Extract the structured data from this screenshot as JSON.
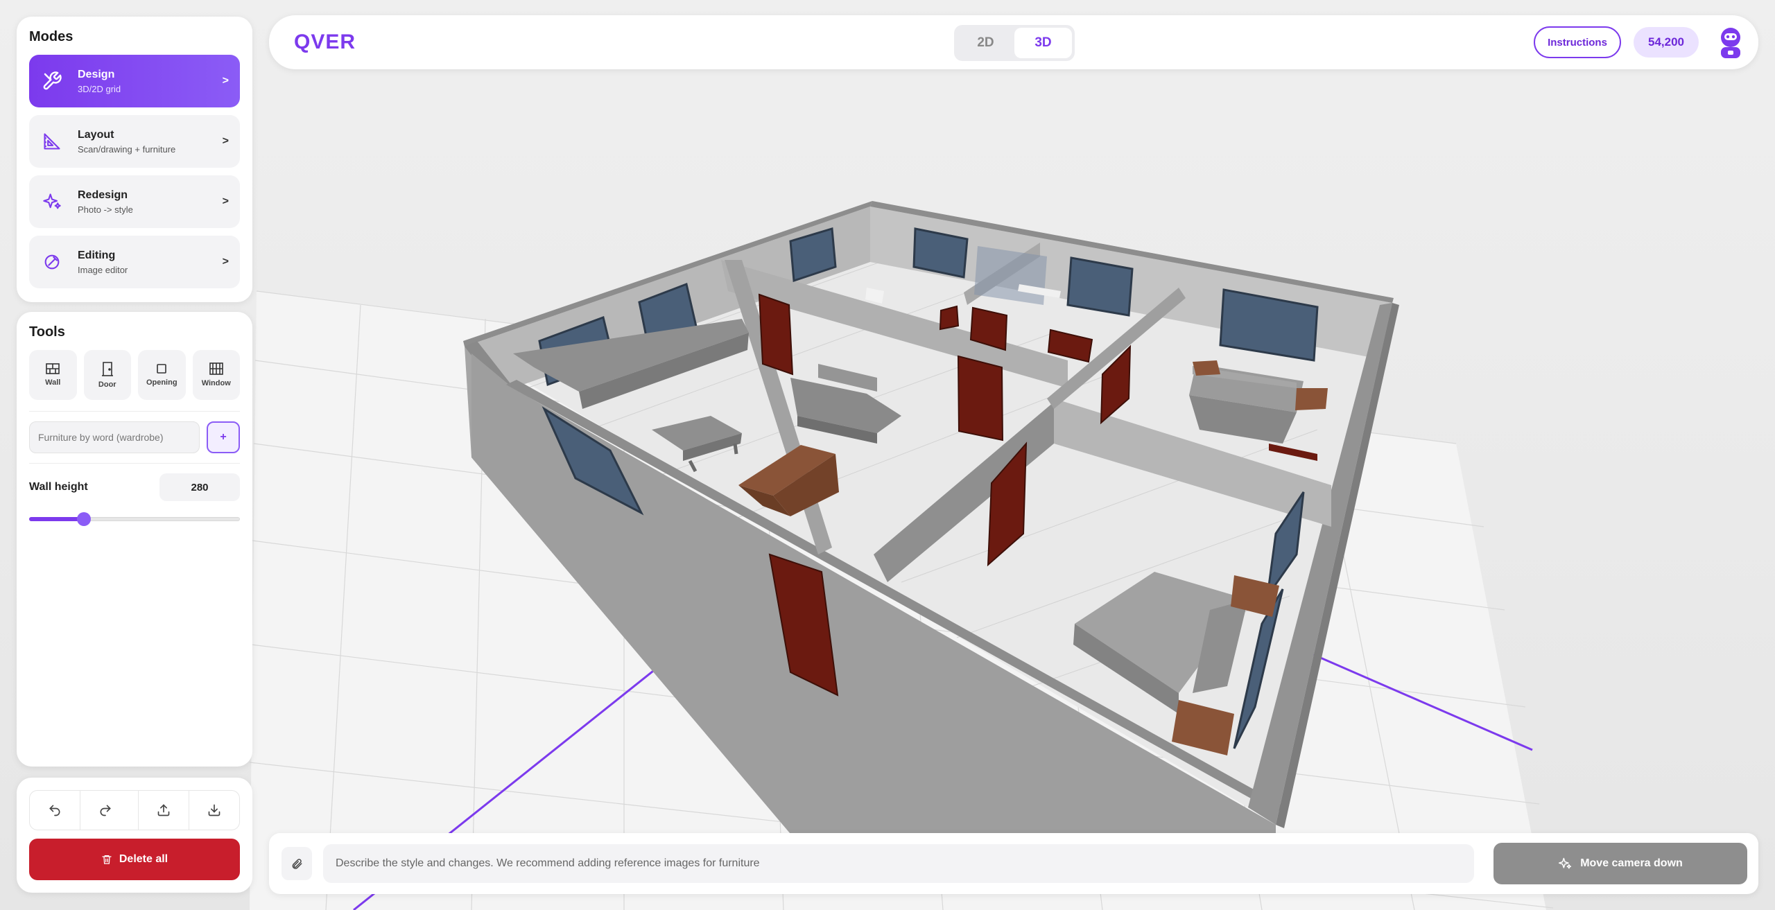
{
  "modes": {
    "title": "Modes",
    "items": [
      {
        "label": "Design",
        "sub": "3D/2D grid",
        "chevron": ">",
        "icon": "tools-icon"
      },
      {
        "label": "Layout",
        "sub": "Scan/drawing + furniture",
        "chevron": ">",
        "icon": "set-square-icon"
      },
      {
        "label": "Redesign",
        "sub": "Photo -> style",
        "chevron": ">",
        "icon": "sparkles-icon"
      },
      {
        "label": "Editing",
        "sub": "Image editor",
        "chevron": ">",
        "icon": "edit-icon"
      }
    ]
  },
  "tools": {
    "title": "Tools",
    "buttons": [
      {
        "label": "Wall",
        "icon": "wall-icon"
      },
      {
        "label": "Door",
        "icon": "door-icon"
      },
      {
        "label": "Opening",
        "icon": "opening-icon"
      },
      {
        "label": "Window",
        "icon": "window-icon"
      }
    ],
    "furniture_placeholder": "Furniture by word (wardrobe)",
    "add_label": "+",
    "wall_height_label": "Wall height",
    "wall_height_value": "280",
    "wall_height_fraction": 0.26
  },
  "actions": {
    "delete_label": "Delete all",
    "icons": [
      "undo-icon",
      "redo-icon",
      "upload-icon",
      "download-icon"
    ]
  },
  "topbar": {
    "logo": "QVER",
    "view_2d": "2D",
    "view_3d": "3D",
    "active_view": "3D",
    "instructions": "Instructions",
    "credits": "54,200"
  },
  "prompt": {
    "placeholder": "Describe the style and changes. We recommend adding reference images for furniture",
    "camera_button": "Move camera down"
  },
  "colors": {
    "accent": "#7c3aed",
    "danger": "#c81e2c",
    "wall": "#a9a9a9",
    "door": "#6b1a10",
    "window": "#4a5f78",
    "wood": "#8a5438"
  }
}
